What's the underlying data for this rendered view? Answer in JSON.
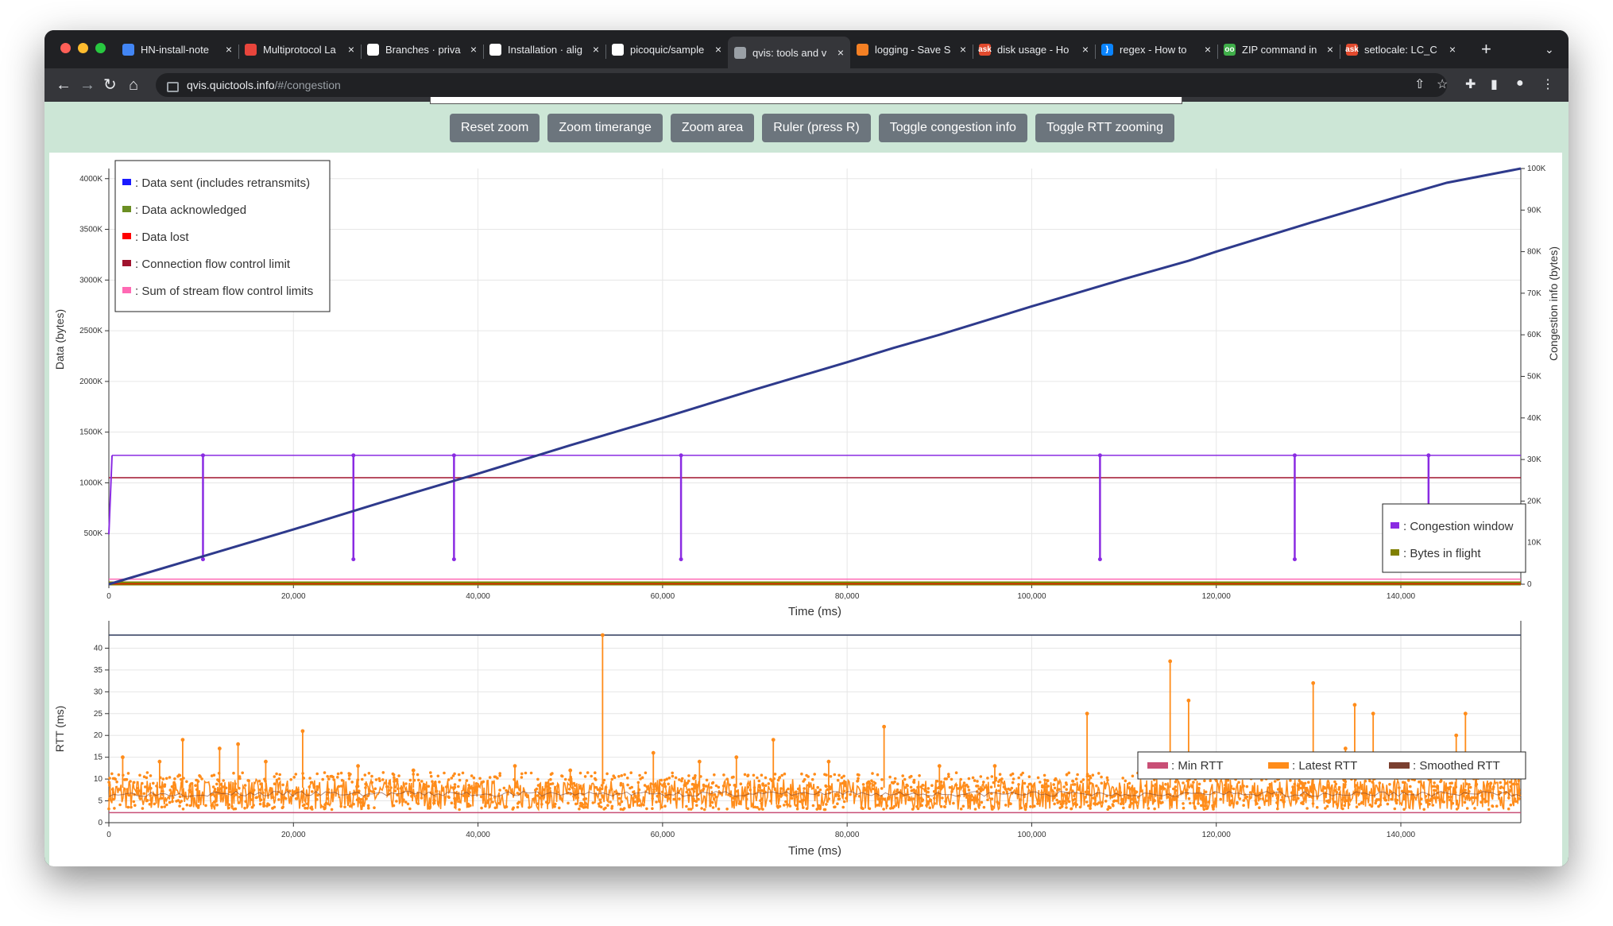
{
  "browser": {
    "tabs": [
      {
        "title": "HN-install-note",
        "fav_color": "#4285f4",
        "fav_glyph": ""
      },
      {
        "title": "Multiprotocol La",
        "fav_color": "#e8453c",
        "fav_glyph": ""
      },
      {
        "title": "Branches · priva",
        "fav_color": "#ffffff",
        "fav_glyph": ""
      },
      {
        "title": "Installation · alig",
        "fav_color": "#ffffff",
        "fav_glyph": ""
      },
      {
        "title": "picoquic/sample",
        "fav_color": "#ffffff",
        "fav_glyph": ""
      },
      {
        "title": "qvis: tools and v",
        "fav_color": "#9aa0a6",
        "fav_glyph": ""
      },
      {
        "title": "logging - Save S",
        "fav_color": "#f48024",
        "fav_glyph": ""
      },
      {
        "title": "disk usage - Ho",
        "fav_color": "#e24a2e",
        "fav_glyph": "ask"
      },
      {
        "title": "regex - How to",
        "fav_color": "#0a84ff",
        "fav_glyph": "}"
      },
      {
        "title": "ZIP command in",
        "fav_color": "#3fae49",
        "fav_glyph": "oo"
      },
      {
        "title": "setlocale: LC_C",
        "fav_color": "#e24a2e",
        "fav_glyph": "ask"
      }
    ],
    "active_tab": 5,
    "new_tab_label": "+",
    "url_host": "qvis.quictools.info",
    "url_path": "/#/congestion"
  },
  "toolbar": {
    "buttons": [
      "Reset zoom",
      "Zoom timerange",
      "Zoom area",
      "Ruler (press R)",
      "Toggle congestion info",
      "Toggle RTT zooming"
    ]
  },
  "colors": {
    "data_sent": "#2e3a8c",
    "data_acked": "#6b8e23",
    "data_lost": "#ff0000",
    "conn_fc": "#a0132e",
    "stream_fc": "#ff69b4",
    "cwnd": "#8a2be2",
    "bif": "#808000",
    "min_rtt": "#c94f76",
    "latest_rtt": "#ff8c1a",
    "smoothed_rtt": "#7a3f2f"
  },
  "chart_data": [
    {
      "type": "line",
      "xlabel": "Time (ms)",
      "ylabel": "Data (bytes)",
      "y2label": "Congestion info (bytes)",
      "xlim": [
        0,
        153000
      ],
      "ylim": [
        0,
        4100000
      ],
      "y2lim": [
        0,
        100000
      ],
      "xticks": [
        "0",
        "20,000",
        "40,000",
        "60,000",
        "80,000",
        "100,000",
        "120,000",
        "140,000"
      ],
      "yticks": [
        "500K",
        "1000K",
        "1500K",
        "2000K",
        "2500K",
        "3000K",
        "3500K",
        "4000K"
      ],
      "y2ticks": [
        "0",
        "10K",
        "20K",
        "30K",
        "40K",
        "50K",
        "60K",
        "70K",
        "80K",
        "90K",
        "100K"
      ],
      "legend_main": [
        {
          "name": ": Data sent (includes retransmits)",
          "color": "#1a1aff"
        },
        {
          "name": ": Data acknowledged",
          "color": "#6b8e23"
        },
        {
          "name": ": Data lost",
          "color": "#ff0000"
        },
        {
          "name": ": Connection flow control limit",
          "color": "#a0132e"
        },
        {
          "name": ": Sum of stream flow control limits",
          "color": "#ff69b4"
        }
      ],
      "legend_congestion": [
        {
          "name": ": Congestion window",
          "color": "#8a2be2"
        },
        {
          "name": ": Bytes in flight",
          "color": "#808000"
        }
      ],
      "series": [
        {
          "name": "Data sent (includes retransmits)",
          "x": [
            0,
            10000,
            20000,
            30000,
            40000,
            50000,
            60000,
            70000,
            80000,
            85000,
            90000,
            100000,
            110000,
            117000,
            120000,
            130000,
            140000,
            145000,
            153000
          ],
          "values": [
            0,
            270000,
            540000,
            820000,
            1090000,
            1370000,
            1640000,
            1920000,
            2190000,
            2330000,
            2460000,
            2740000,
            3010000,
            3190000,
            3280000,
            3560000,
            3830000,
            3960000,
            4100000
          ]
        },
        {
          "name": "Connection flow control limit",
          "x": [
            0,
            153000
          ],
          "values": [
            1050000,
            1050000
          ]
        },
        {
          "name": "Congestion window",
          "x": [
            0,
            500,
            10200,
            26500,
            37400,
            62000,
            107400,
            128500,
            143000,
            153000
          ],
          "values": [
            31000,
            31000,
            31000,
            31000,
            31000,
            31000,
            31000,
            31000,
            31000,
            31000
          ],
          "dips_at": [
            10200,
            26500,
            37400,
            62000,
            107400,
            128500,
            143000
          ],
          "dip_value": 6000
        }
      ]
    },
    {
      "type": "scatter",
      "xlabel": "Time (ms)",
      "ylabel": "RTT (ms)",
      "xlim": [
        0,
        153000
      ],
      "ylim": [
        0,
        43
      ],
      "xticks": [
        "0",
        "20,000",
        "40,000",
        "60,000",
        "80,000",
        "100,000",
        "120,000",
        "140,000"
      ],
      "yticks": [
        "0",
        "5",
        "10",
        "15",
        "20",
        "25",
        "30",
        "35",
        "40"
      ],
      "legend": [
        {
          "name": ": Min RTT",
          "color": "#c94f76"
        },
        {
          "name": ": Latest RTT",
          "color": "#ff8c1a"
        },
        {
          "name": ": Smoothed RTT",
          "color": "#7a3f2f"
        }
      ],
      "baseline_band": [
        3,
        10
      ],
      "spikes": [
        {
          "x": 1500,
          "y": 15
        },
        {
          "x": 5500,
          "y": 14
        },
        {
          "x": 8000,
          "y": 19
        },
        {
          "x": 12000,
          "y": 17
        },
        {
          "x": 14000,
          "y": 18
        },
        {
          "x": 17000,
          "y": 14
        },
        {
          "x": 21000,
          "y": 21
        },
        {
          "x": 27000,
          "y": 13
        },
        {
          "x": 33000,
          "y": 12
        },
        {
          "x": 44000,
          "y": 13
        },
        {
          "x": 50000,
          "y": 12
        },
        {
          "x": 53500,
          "y": 43
        },
        {
          "x": 59000,
          "y": 16
        },
        {
          "x": 64000,
          "y": 14
        },
        {
          "x": 68000,
          "y": 15
        },
        {
          "x": 72000,
          "y": 19
        },
        {
          "x": 78000,
          "y": 14
        },
        {
          "x": 84000,
          "y": 22
        },
        {
          "x": 90000,
          "y": 13
        },
        {
          "x": 96000,
          "y": 13
        },
        {
          "x": 106000,
          "y": 25
        },
        {
          "x": 115000,
          "y": 37
        },
        {
          "x": 117000,
          "y": 28
        },
        {
          "x": 121000,
          "y": 13
        },
        {
          "x": 130500,
          "y": 32
        },
        {
          "x": 134000,
          "y": 17
        },
        {
          "x": 135000,
          "y": 27
        },
        {
          "x": 137000,
          "y": 25
        },
        {
          "x": 146000,
          "y": 20
        },
        {
          "x": 147000,
          "y": 25
        },
        {
          "x": 152000,
          "y": 11
        }
      ]
    }
  ]
}
